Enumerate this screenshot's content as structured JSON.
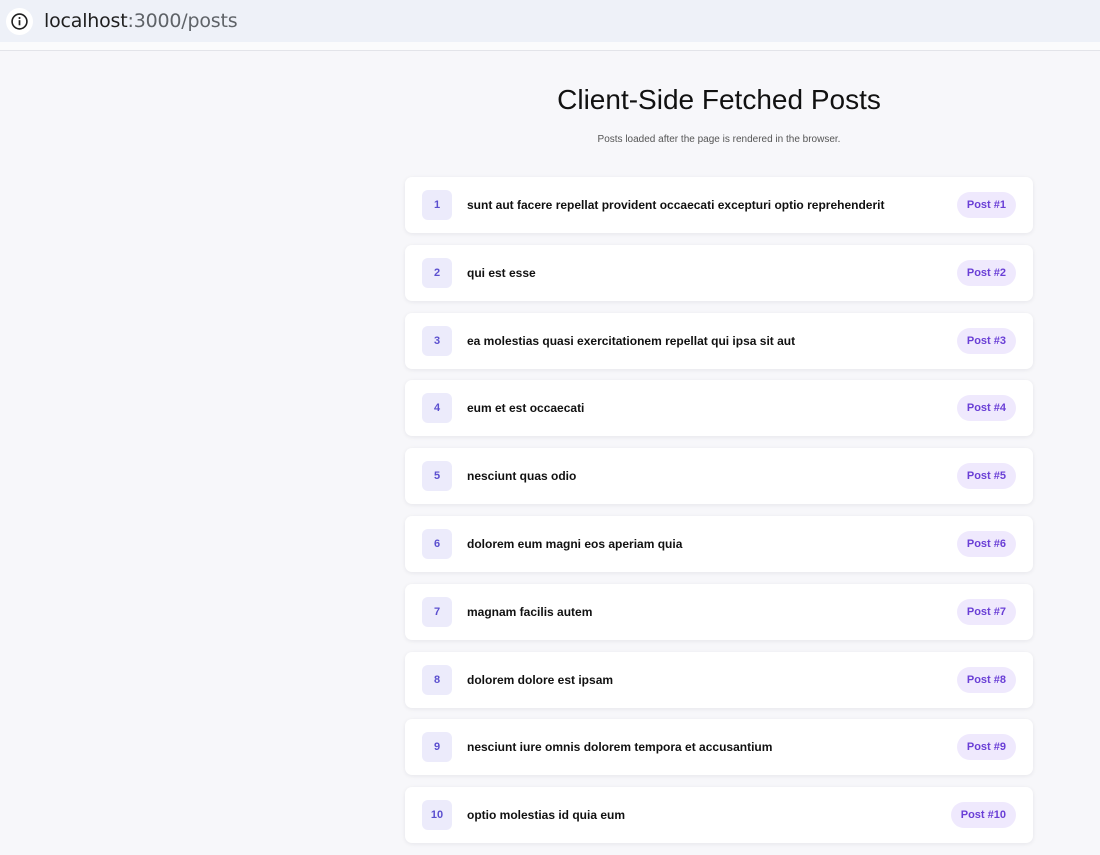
{
  "browser": {
    "url_host": "localhost",
    "url_rest": ":3000/posts"
  },
  "page": {
    "title": "Client-Side Fetched Posts",
    "subtitle": "Posts loaded after the page is rendered in the browser."
  },
  "posts": [
    {
      "num": "1",
      "title": "sunt aut facere repellat provident occaecati excepturi optio reprehenderit",
      "badge": "Post #1"
    },
    {
      "num": "2",
      "title": "qui est esse",
      "badge": "Post #2"
    },
    {
      "num": "3",
      "title": "ea molestias quasi exercitationem repellat qui ipsa sit aut",
      "badge": "Post #3"
    },
    {
      "num": "4",
      "title": "eum et est occaecati",
      "badge": "Post #4"
    },
    {
      "num": "5",
      "title": "nesciunt quas odio",
      "badge": "Post #5"
    },
    {
      "num": "6",
      "title": "dolorem eum magni eos aperiam quia",
      "badge": "Post #6"
    },
    {
      "num": "7",
      "title": "magnam facilis autem",
      "badge": "Post #7"
    },
    {
      "num": "8",
      "title": "dolorem dolore est ipsam",
      "badge": "Post #8"
    },
    {
      "num": "9",
      "title": "nesciunt iure omnis dolorem tempora et accusantium",
      "badge": "Post #9"
    },
    {
      "num": "10",
      "title": "optio molestias id quia eum",
      "badge": "Post #10"
    }
  ],
  "icons": {
    "site_info": "info-circle-icon"
  },
  "colors": {
    "accent": "#5b4fcf",
    "badge_text": "#6a3fd6",
    "badge_bg": "#efe9fd",
    "number_bg": "#ecebfb"
  }
}
